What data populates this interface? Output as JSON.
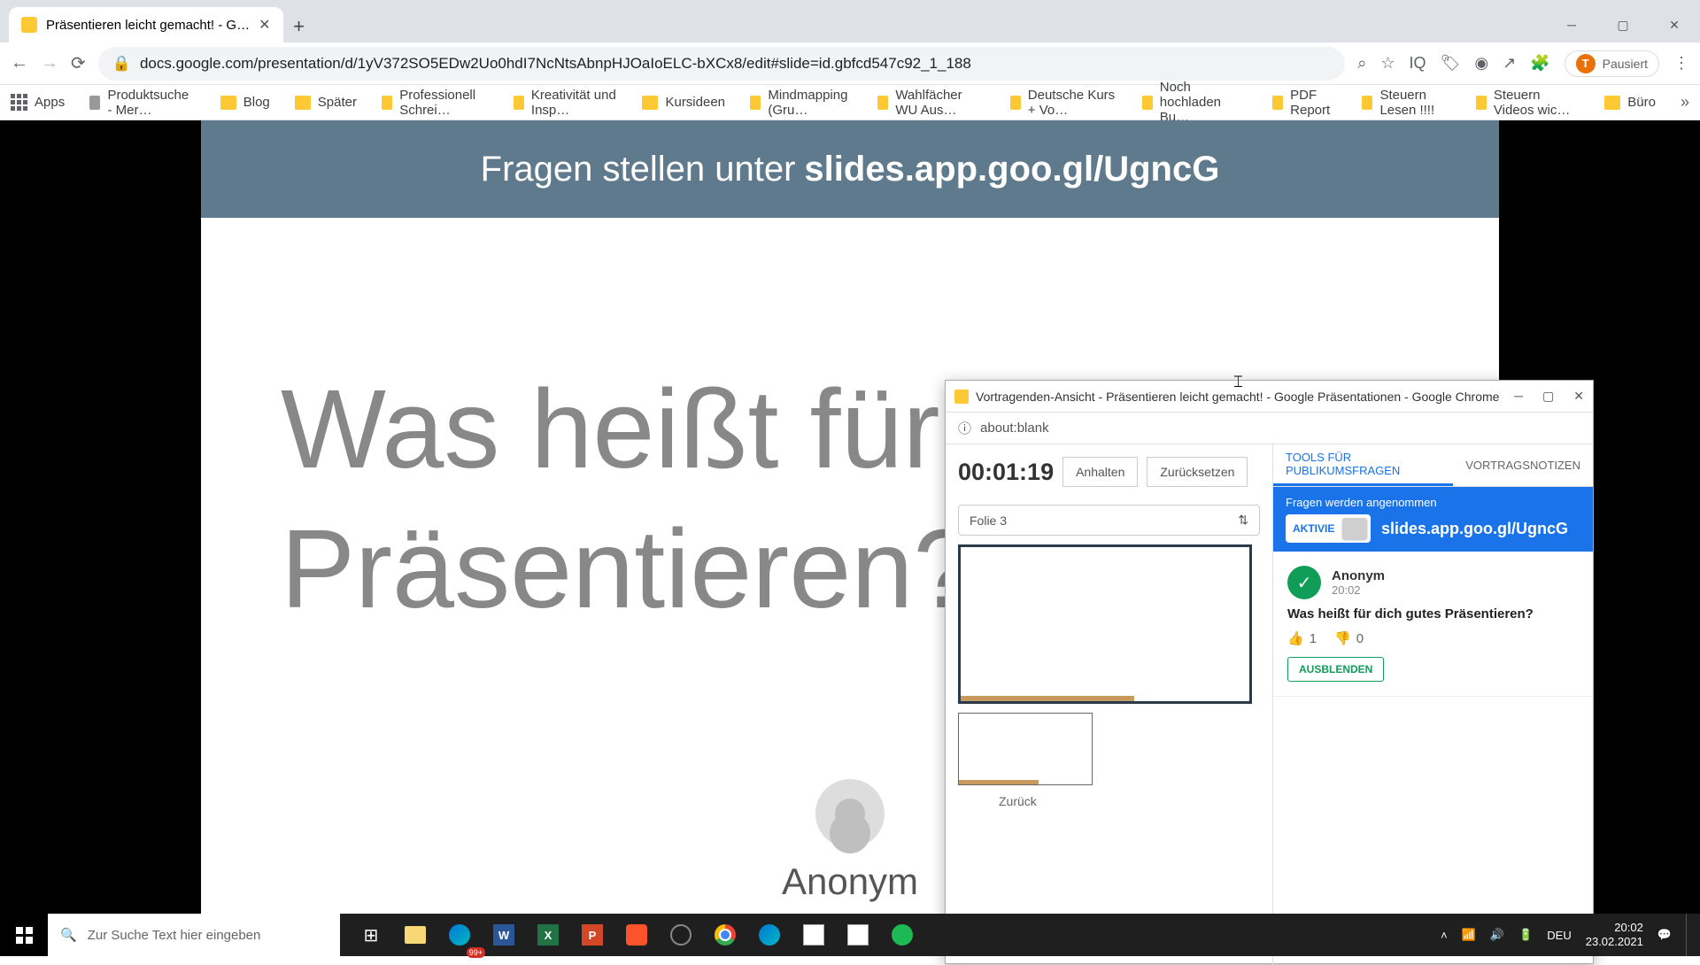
{
  "browser": {
    "tab_title": "Präsentieren leicht gemacht! - G…",
    "url": "docs.google.com/presentation/d/1yV372SO5EDw2Uo0hdI7NcNtsAbnpHJOaIoELC-bXCx8/edit#slide=id.gbfcd547c92_1_188",
    "profile_state": "Pausiert",
    "profile_initial": "T"
  },
  "bookmarks": {
    "apps": "Apps",
    "b1": "Produktsuche - Mer…",
    "b2": "Blog",
    "b3": "Später",
    "b4": "Professionell Schrei…",
    "b5": "Kreativität und Insp…",
    "b6": "Kursideen",
    "b7": "Mindmapping (Gru…",
    "b8": "Wahlfächer WU Aus…",
    "b9": "Deutsche Kurs + Vo…",
    "b10": "Noch hochladen Bu…",
    "b11": "PDF Report",
    "b12": "Steuern Lesen !!!!",
    "b13": "Steuern Videos wic…",
    "b14": "Büro"
  },
  "slide": {
    "banner_pre": "Fragen stellen unter",
    "banner_bold": "slides.app.goo.gl/UgncG",
    "question_l1": "Was heißt für d",
    "question_l2": "Präsentieren?",
    "anon_name": "Anonym"
  },
  "popup": {
    "title": "Vortragenden-Ansicht - Präsentieren leicht gemacht! - Google Präsentationen - Google Chrome",
    "addr": "about:blank",
    "timer": "00:01:19",
    "pause": "Anhalten",
    "reset": "Zurücksetzen",
    "folie": "Folie 3",
    "zuruck": "Zurück",
    "tab1": "TOOLS FÜR PUBLIKUMSFRAGEN",
    "tab2": "VORTRAGSNOTIZEN",
    "accepting": "Fragen werden angenommen",
    "toggle": "AKTIVIE",
    "link": "slides.app.goo.gl/UgncG",
    "q_name": "Anonym",
    "q_time": "20:02",
    "q_text": "Was heißt für dich gutes Präsentieren?",
    "like_count": "1",
    "dislike_count": "0",
    "hide_btn": "AUSBLENDEN"
  },
  "taskbar": {
    "search_placeholder": "Zur Suche Text hier eingeben",
    "badge": "99+",
    "lang": "DEU",
    "time": "20:02",
    "date": "23.02.2021"
  }
}
